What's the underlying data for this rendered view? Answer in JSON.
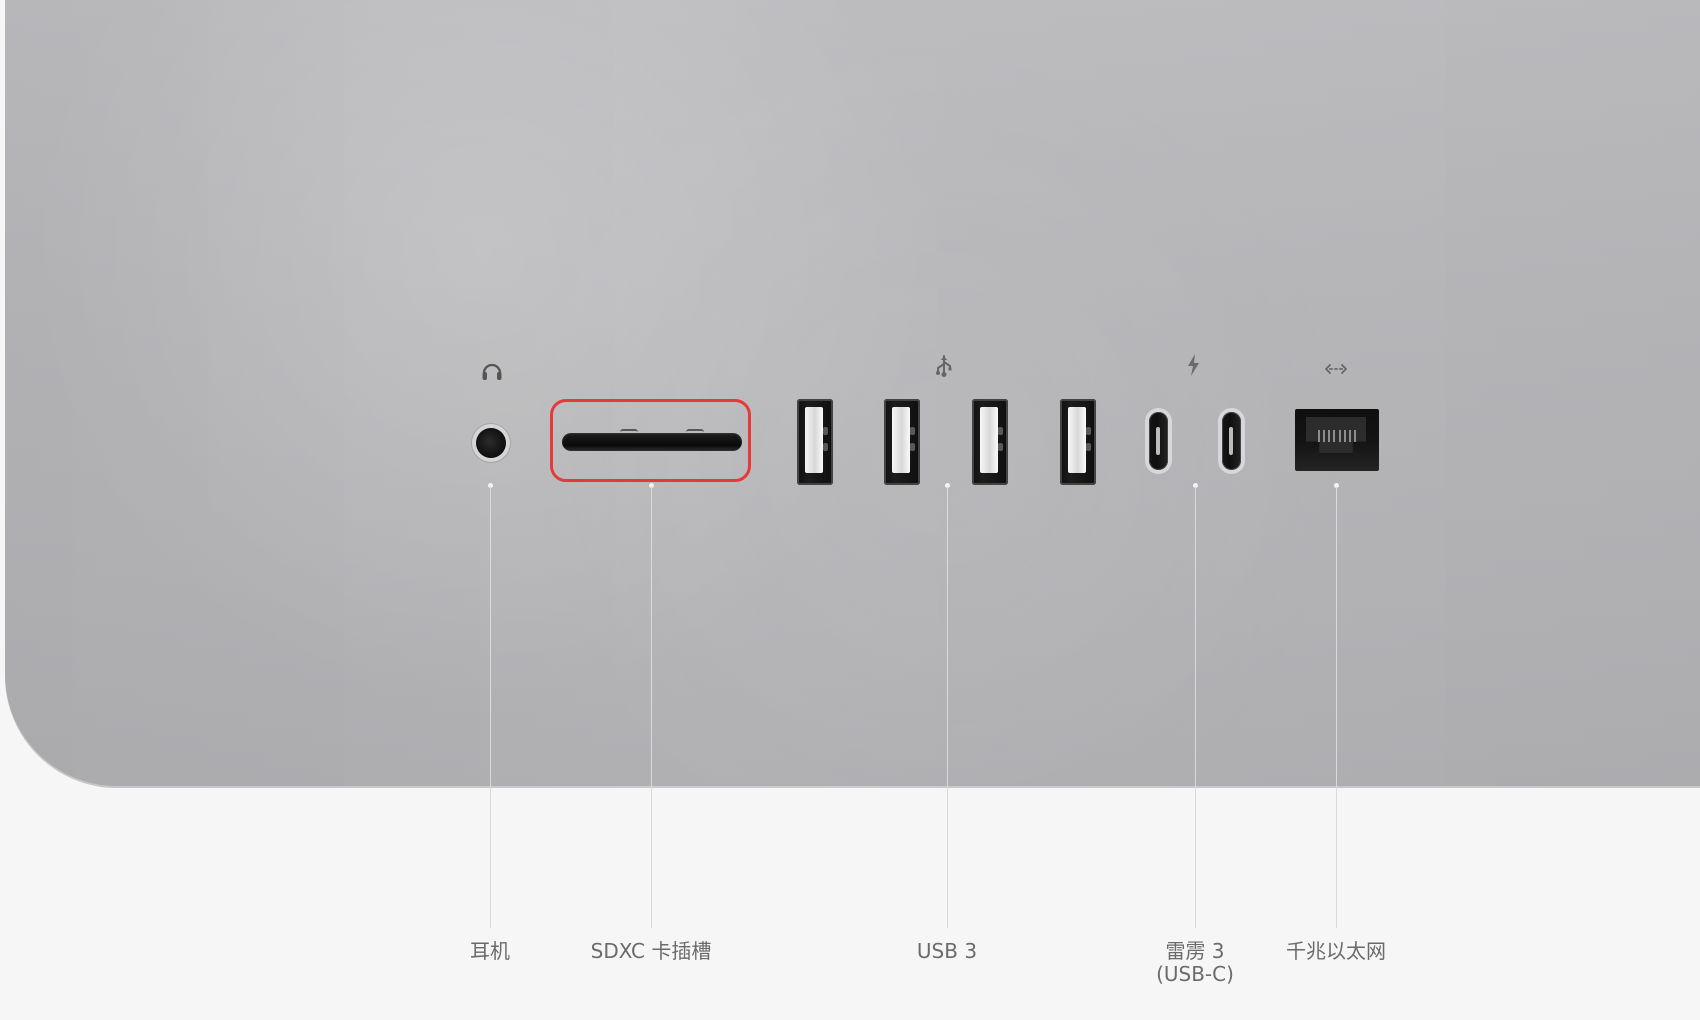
{
  "ports": [
    {
      "id": "headphone",
      "label": "耳机",
      "icon": "headphones-icon"
    },
    {
      "id": "sdxc",
      "label": "SDXC 卡插槽",
      "icon": "sdxc-card-slot"
    },
    {
      "id": "usb3",
      "label": "USB 3",
      "icon": "usb-icon"
    },
    {
      "id": "thunderbolt3",
      "label": "雷雳 3\n(USB-C)",
      "icon": "thunderbolt-icon"
    },
    {
      "id": "ethernet",
      "label": "千兆以太网",
      "icon": "ethernet-icon"
    }
  ],
  "colors": {
    "panel": "#b8b8bb",
    "background": "#f6f6f6",
    "highlight": "#e63939",
    "line": "#dadadc",
    "text": "#6b6b6b"
  }
}
